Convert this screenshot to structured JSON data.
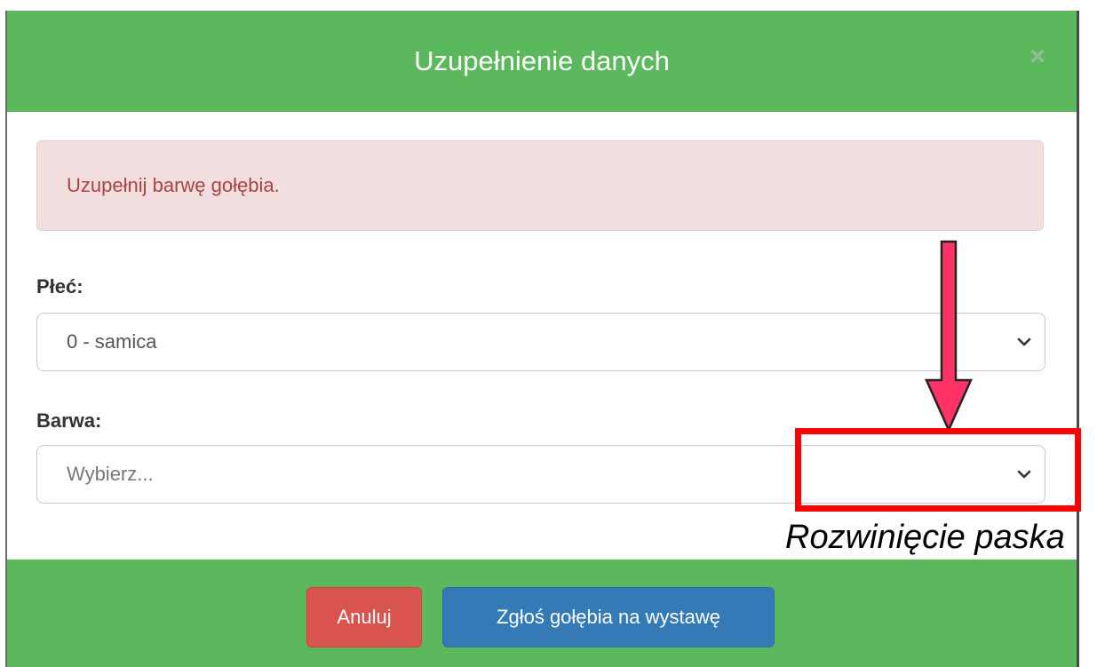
{
  "modal": {
    "title": "Uzupełnienie danych",
    "close_symbol": "×",
    "header_color": "#5cb85c"
  },
  "alert": {
    "message": "Uzupełnij barwę gołębia.",
    "type": "danger"
  },
  "form": {
    "sex": {
      "label": "Płeć:",
      "selected_value": "0 - samica"
    },
    "color": {
      "label": "Barwa:",
      "placeholder": "Wybierz..."
    }
  },
  "footer": {
    "cancel_label": "Anuluj",
    "submit_label": "Zgłoś gołębia na wystawę"
  },
  "annotation": {
    "text": "Rozwinięcie paska",
    "highlight_color": "#ff0000",
    "arrow_color": "#ff3366"
  },
  "icons": {
    "close": "close-icon",
    "dropdown": "chevron-down-icon",
    "pointer": "arrow-down-icon"
  }
}
